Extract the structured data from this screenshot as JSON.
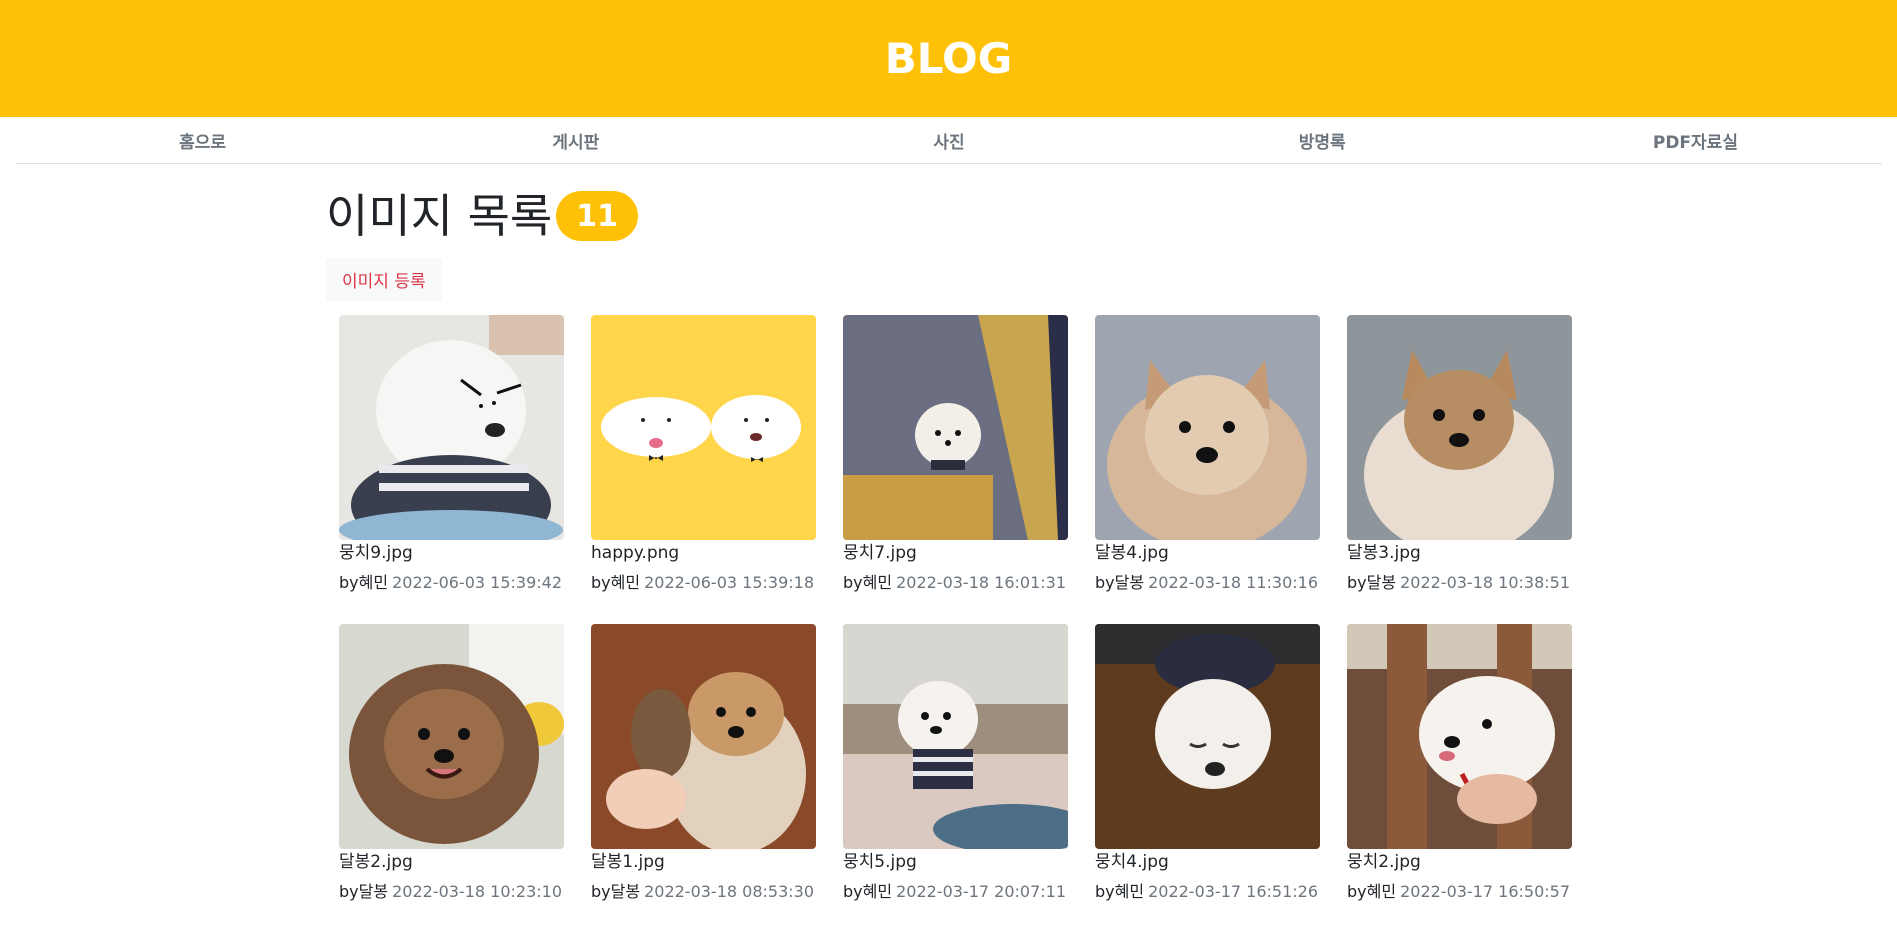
{
  "header": {
    "title": "BLOG"
  },
  "nav": [
    {
      "label": "홈으로"
    },
    {
      "label": "게시판"
    },
    {
      "label": "사진"
    },
    {
      "label": "방명록"
    },
    {
      "label": "PDF자료실"
    }
  ],
  "main": {
    "title": "이미지 목록",
    "count": "11",
    "register_label": "이미지 등록"
  },
  "images": [
    {
      "filename": "뭉치9.jpg",
      "by": "by혜민",
      "date": "2022-06-03 15:39:42",
      "bg": "#e8e6e2"
    },
    {
      "filename": "happy.png",
      "by": "by혜민",
      "date": "2022-06-03 15:39:18",
      "bg": "#ffd54a"
    },
    {
      "filename": "뭉치7.jpg",
      "by": "by혜민",
      "date": "2022-03-18 16:01:31",
      "bg": "#6b6e80"
    },
    {
      "filename": "달봉4.jpg",
      "by": "by달봉",
      "date": "2022-03-18 11:30:16",
      "bg": "#9ea5b0"
    },
    {
      "filename": "달봉3.jpg",
      "by": "by달봉",
      "date": "2022-03-18 10:38:51",
      "bg": "#8f969b"
    },
    {
      "filename": "달봉2.jpg",
      "by": "by달봉",
      "date": "2022-03-18 10:23:10",
      "bg": "#d7d8d0"
    },
    {
      "filename": "달봉1.jpg",
      "by": "by달봉",
      "date": "2022-03-18 08:53:30",
      "bg": "#8a4a2a"
    },
    {
      "filename": "뭉치5.jpg",
      "by": "by혜민",
      "date": "2022-03-17 20:07:11",
      "bg": "#9e8e7e"
    },
    {
      "filename": "뭉치4.jpg",
      "by": "by혜민",
      "date": "2022-03-17 16:51:26",
      "bg": "#5e3a1e"
    },
    {
      "filename": "뭉치2.jpg",
      "by": "by혜민",
      "date": "2022-03-17 16:50:57",
      "bg": "#6e4e3a"
    }
  ]
}
